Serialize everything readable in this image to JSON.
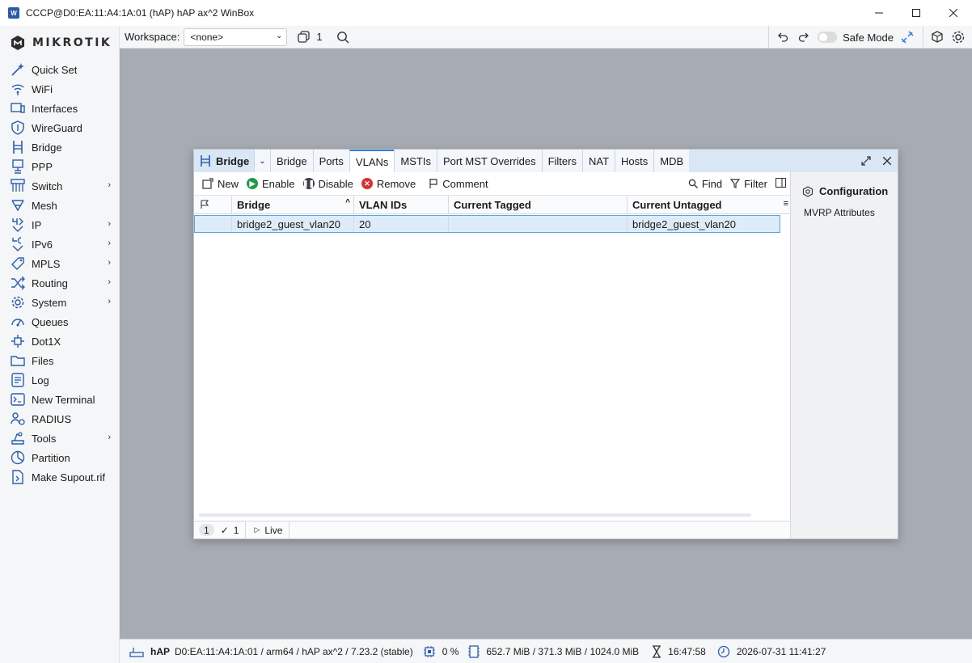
{
  "window": {
    "title": "CCCP@D0:EA:11:A4:1A:01 (hAP) hAP ax^2 WinBox",
    "app_icon": "W"
  },
  "brand": {
    "logo_text": "MIKROTIK"
  },
  "sidebar": {
    "items": [
      {
        "label": "Quick Set",
        "icon": "wand-icon",
        "submenu": false
      },
      {
        "label": "WiFi",
        "icon": "wifi-icon",
        "submenu": false
      },
      {
        "label": "Interfaces",
        "icon": "interfaces-icon",
        "submenu": false
      },
      {
        "label": "WireGuard",
        "icon": "shield-icon",
        "submenu": false
      },
      {
        "label": "Bridge",
        "icon": "bridge-icon",
        "submenu": false
      },
      {
        "label": "PPP",
        "icon": "ppp-icon",
        "submenu": false
      },
      {
        "label": "Switch",
        "icon": "switch-icon",
        "submenu": true
      },
      {
        "label": "Mesh",
        "icon": "mesh-icon",
        "submenu": false
      },
      {
        "label": "IP",
        "icon": "ipv4-icon",
        "submenu": true
      },
      {
        "label": "IPv6",
        "icon": "ipv6-icon",
        "submenu": true
      },
      {
        "label": "MPLS",
        "icon": "tag-icon",
        "submenu": true
      },
      {
        "label": "Routing",
        "icon": "routing-icon",
        "submenu": true
      },
      {
        "label": "System",
        "icon": "gear-icon",
        "submenu": true
      },
      {
        "label": "Queues",
        "icon": "gauge-icon",
        "submenu": false
      },
      {
        "label": "Dot1X",
        "icon": "dot1x-icon",
        "submenu": false
      },
      {
        "label": "Files",
        "icon": "folder-icon",
        "submenu": false
      },
      {
        "label": "Log",
        "icon": "log-icon",
        "submenu": false
      },
      {
        "label": "New Terminal",
        "icon": "terminal-icon",
        "submenu": false
      },
      {
        "label": "RADIUS",
        "icon": "radius-icon",
        "submenu": false
      },
      {
        "label": "Tools",
        "icon": "tools-icon",
        "submenu": true
      },
      {
        "label": "Partition",
        "icon": "partition-icon",
        "submenu": false
      },
      {
        "label": "Make Supout.rif",
        "icon": "supout-icon",
        "submenu": false
      }
    ]
  },
  "toolbar": {
    "workspace_label": "Workspace:",
    "workspace_value": "<none>",
    "windows_count": "1",
    "safe_mode_label": "Safe Mode"
  },
  "bridge_window": {
    "title": "Bridge",
    "tabs": [
      "Bridge",
      "Ports",
      "VLANs",
      "MSTIs",
      "Port MST Overrides",
      "Filters",
      "NAT",
      "Hosts",
      "MDB"
    ],
    "active_tab": "VLANs",
    "actions": {
      "new": "New",
      "enable": "Enable",
      "disable": "Disable",
      "remove": "Remove",
      "comment": "Comment",
      "find": "Find",
      "filter": "Filter"
    },
    "columns": [
      "Bridge",
      "VLAN IDs",
      "Current Tagged",
      "Current Untagged"
    ],
    "rows": [
      {
        "bridge": "bridge2_guest_vlan20",
        "vlan_ids": "20",
        "current_tagged": "",
        "current_untagged": "bridge2_guest_vlan20"
      }
    ],
    "status": {
      "count": "1",
      "selected": "1",
      "live": "Live"
    },
    "side_panel": {
      "heading": "Configuration",
      "items": [
        "MVRP Attributes"
      ]
    }
  },
  "statusbar": {
    "device": "hAP",
    "device_info": "D0:EA:11:A4:1A:01 / arm64 / hAP ax^2 / 7.23.2 (stable)",
    "cpu": "0 %",
    "memory": "652.7 MiB / 371.3 MiB / 1024.0 MiB",
    "uptime": "16:47:58",
    "datetime": "2026-07-31 11:41:27"
  },
  "colors": {
    "accent": "#2a5db0",
    "enable": "#1f9a4a",
    "remove": "#d93030",
    "disable": "#3b3f45",
    "workspace": "#a7abb2"
  }
}
